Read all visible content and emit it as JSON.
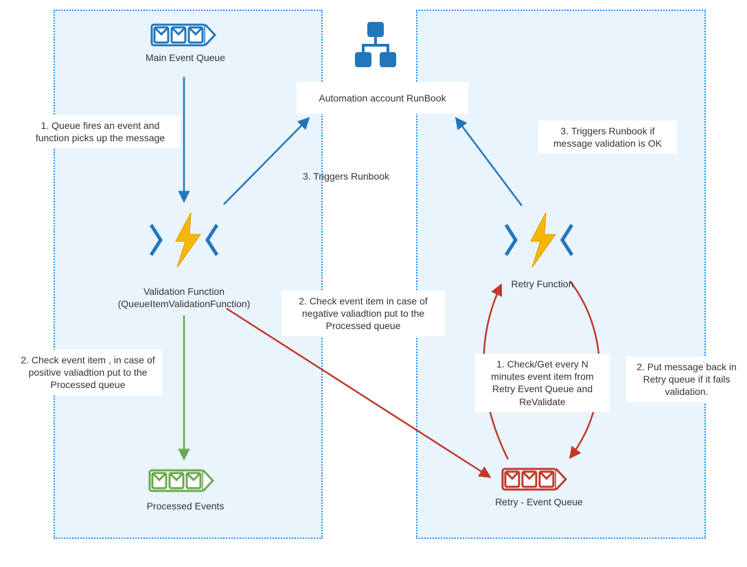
{
  "nodes": {
    "mainQueueLabel": "Main Event Queue",
    "validationFnLine1": "Validation Function",
    "validationFnLine2": "(QueueItemValidationFunction)",
    "processedLabel": "Processed Events",
    "runbookLabel": "Automation account RunBook",
    "retryFnLabel": "Retry  Function",
    "retryQueueLabel": "Retry - Event Queue"
  },
  "notes": {
    "left1": "1. Queue fires an event and function picks up the message",
    "left2": "2. Check event item , in case of positive valiadtion put to the Processed queue",
    "leftTrig": "3. Triggers Runbook",
    "centerNeg": "2. Check event item in case of negative valiadtion put to the Processed queue",
    "retryCheck": "1. Check/Get every N minutes event item from Retry Event Queue and ReValidate",
    "retryBack": "2. Put message back in Retry queue if it fails validation.",
    "rightTrig": "3. Triggers Runbook if message validation is OK"
  },
  "colors": {
    "blue": "#2176bc",
    "green": "#6aa84f",
    "red": "#c0392b",
    "yellow": "#f6b700"
  }
}
